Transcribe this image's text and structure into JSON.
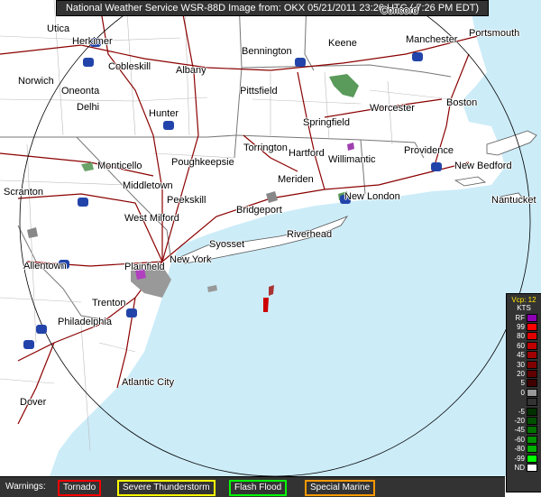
{
  "header": {
    "title": "National Weather Service WSR-88D Image from: OKX 05/21/2011 23:26 UTC ( 7:26 PM EDT)"
  },
  "places": [
    {
      "name": "Concord"
    },
    {
      "name": "Utica"
    },
    {
      "name": "Herkimer"
    },
    {
      "name": "Keene"
    },
    {
      "name": "Manchester"
    },
    {
      "name": "Portsmouth"
    },
    {
      "name": "Bennington"
    },
    {
      "name": "Cobleskill"
    },
    {
      "name": "Albany"
    },
    {
      "name": "Norwich"
    },
    {
      "name": "Oneonta"
    },
    {
      "name": "Pittsfield"
    },
    {
      "name": "Delhi"
    },
    {
      "name": "Hunter"
    },
    {
      "name": "Worcester"
    },
    {
      "name": "Boston"
    },
    {
      "name": "Springfield"
    },
    {
      "name": "Torrington"
    },
    {
      "name": "Hartford"
    },
    {
      "name": "Providence"
    },
    {
      "name": "Willimantic"
    },
    {
      "name": "New Bedford"
    },
    {
      "name": "Monticello"
    },
    {
      "name": "Poughkeepsie"
    },
    {
      "name": "Middletown"
    },
    {
      "name": "Meriden"
    },
    {
      "name": "New London"
    },
    {
      "name": "Nantucket"
    },
    {
      "name": "Scranton"
    },
    {
      "name": "Peekskill"
    },
    {
      "name": "Bridgeport"
    },
    {
      "name": "West Milford"
    },
    {
      "name": "Riverhead"
    },
    {
      "name": "Syosset"
    },
    {
      "name": "Allentown"
    },
    {
      "name": "Plainfield"
    },
    {
      "name": "New York"
    },
    {
      "name": "Trenton"
    },
    {
      "name": "Philadelphia"
    },
    {
      "name": "Atlantic City"
    },
    {
      "name": "Dover"
    }
  ],
  "legend": {
    "header": "Vcp: 12",
    "units": "KTS",
    "rows": [
      {
        "label": "RF",
        "color": "#8e00b4"
      },
      {
        "label": "99",
        "color": "#ff0000"
      },
      {
        "label": "80",
        "color": "#e00000"
      },
      {
        "label": "60",
        "color": "#c00000"
      },
      {
        "label": "45",
        "color": "#a00000"
      },
      {
        "label": "30",
        "color": "#800000"
      },
      {
        "label": "20",
        "color": "#600000"
      },
      {
        "label": "5",
        "color": "#400000"
      },
      {
        "label": "0",
        "color": "#999999"
      },
      {
        "label": "",
        "color": "#333333"
      },
      {
        "label": "-5",
        "color": "#003000"
      },
      {
        "label": "-20",
        "color": "#005000"
      },
      {
        "label": "-45",
        "color": "#007000"
      },
      {
        "label": "-60",
        "color": "#009000"
      },
      {
        "label": "-80",
        "color": "#00b000"
      },
      {
        "label": "-99",
        "color": "#00ff00"
      },
      {
        "label": "ND",
        "color": "#ffffff"
      }
    ]
  },
  "warnings": {
    "label": "Warnings:",
    "items": [
      {
        "label": "Tornado",
        "color": "#ff0000"
      },
      {
        "label": "Severe Thunderstorm",
        "color": "#ffff00"
      },
      {
        "label": "Flash Flood",
        "color": "#00ff00"
      },
      {
        "label": "Special Marine",
        "color": "#ff9900"
      }
    ]
  },
  "colors": {
    "ocean": "#ccecf8",
    "land": "#ffffff",
    "roads": "#8b0000",
    "boundaries": "#777777",
    "range_ring": "#000000"
  }
}
